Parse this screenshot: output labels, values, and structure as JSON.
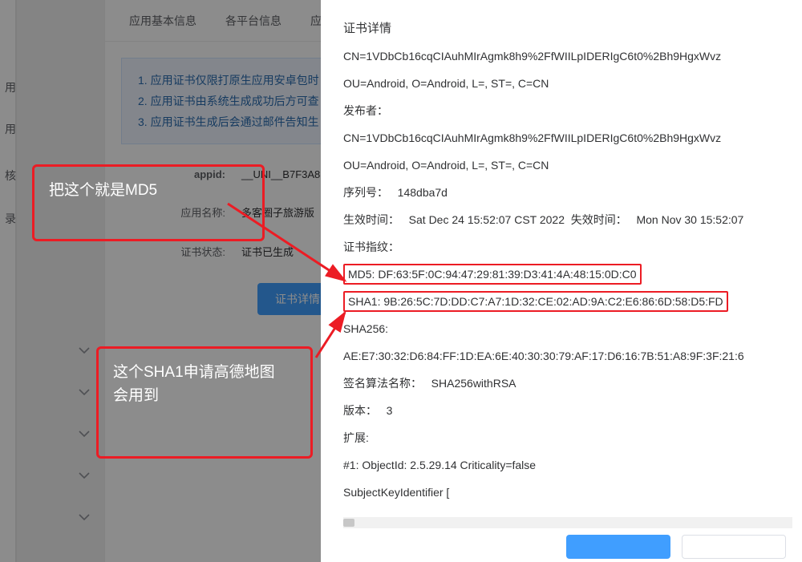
{
  "leftnav": {
    "items": [
      "用",
      "用",
      "核",
      "录"
    ]
  },
  "tabs": {
    "t1": "应用基本信息",
    "t2": "各平台信息",
    "t3": "应"
  },
  "infobox": {
    "l1": "1. 应用证书仅限打原生应用安卓包时",
    "l2": "2. 应用证书由系统生成成功后方可查",
    "l3": "3. 应用证书生成后会通过邮件告知生"
  },
  "form": {
    "appid_label": "appid:",
    "appid_value": "__UNI__B7F3A8",
    "appname_label": "应用名称:",
    "appname_value": "多客圈子旅游版",
    "cert_state_label": "证书状态:",
    "cert_state_value": "证书已生成",
    "cert_btn": "证书详情"
  },
  "modal": {
    "title": "证书详情",
    "line_cn1": "CN=1VDbCb16cqCIAuhMIrAgmk8h9%2FfWIILpIDERIgC6t0%2Bh9HgxWvz",
    "line_ou1": "OU=Android, O=Android, L=, ST=, C=CN",
    "publisher_label": "发布者：",
    "line_cn2": "CN=1VDbCb16cqCIAuhMIrAgmk8h9%2FfWIILpIDERIgC6t0%2Bh9HgxWvz",
    "line_ou2": "OU=Android, O=Android, L=, ST=, C=CN",
    "serial_label": "序列号：",
    "serial_value": "148dba7d",
    "effective_label": "生效时间：",
    "effective_value": "Sat Dec 24 15:52:07 CST 2022",
    "expire_label": "失效时间：",
    "expire_value": "Mon Nov 30 15:52:07",
    "fingerprint_label": "证书指纹：",
    "md5_line": "MD5: DF:63:5F:0C:94:47:29:81:39:D3:41:4A:48:15:0D:C0",
    "sha1_line": "SHA1: 9B:26:5C:7D:DD:C7:A7:1D:32:CE:02:AD:9A:C2:E6:86:6D:58:D5:FD",
    "sha256_label": "SHA256:",
    "sha256_value": "AE:E7:30:32:D6:84:FF:1D:EA:6E:40:30:30:79:AF:17:D6:16:7B:51:A8:9F:3F:21:6",
    "sigalg_label": "签名算法名称：",
    "sigalg_value": "SHA256withRSA",
    "version_label": "版本：",
    "version_value": "3",
    "ext_label": "扩展:",
    "ext1": "#1: ObjectId: 2.5.29.14 Criticality=false",
    "ext2": "SubjectKeyIdentifier ["
  },
  "annotations": {
    "a1": "把这个就是MD5",
    "a2_line1": "这个SHA1申请高德地图",
    "a2_line2": "会用到"
  }
}
